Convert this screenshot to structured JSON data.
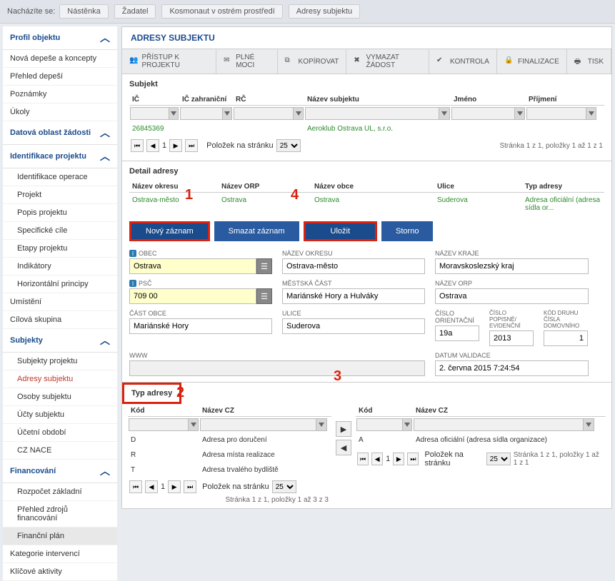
{
  "breadcrumb": {
    "label": "Nacházíte se:",
    "items": [
      "Nástěnka",
      "Žadatel",
      "Kosmonaut v ostrém prostředí",
      "Adresy subjektu"
    ]
  },
  "sidebar": {
    "groups": [
      {
        "title": "Profil objektu",
        "items": [
          "Nová depeše a koncepty",
          "Přehled depeší",
          "Poznámky",
          "Úkoly"
        ]
      },
      {
        "title": "Datová oblast žádosti",
        "items": []
      },
      {
        "title": "Identifikace projektu",
        "items": [
          "Identifikace operace",
          "Projekt",
          "Popis projektu",
          "Specifické cíle",
          "Etapy projektu",
          "Indikátory",
          "Horizontální principy"
        ]
      }
    ],
    "flat1": [
      "Umístění",
      "Cílová skupina"
    ],
    "subjekty": {
      "title": "Subjekty",
      "items": [
        "Subjekty projektu",
        "Adresy subjektu",
        "Osoby subjektu",
        "Účty subjektu",
        "Účetní období",
        "CZ NACE"
      ],
      "active": "Adresy subjektu"
    },
    "financovani": {
      "title": "Financování",
      "items": [
        "Rozpočet základní",
        "Přehled zdrojů financování",
        "Finanční plán"
      ],
      "highlight": "Finanční plán"
    },
    "flat2": [
      "Kategorie intervencí",
      "Klíčové aktivity"
    ]
  },
  "main": {
    "title": "ADRESY SUBJEKTU",
    "toolbar": [
      "PŘÍSTUP K PROJEKTU",
      "PLNÉ MOCI",
      "KOPÍROVAT",
      "VYMAZAT ŽÁDOST",
      "KONTROLA",
      "FINALIZACE",
      "TISK"
    ]
  },
  "subjekt": {
    "title": "Subjekt",
    "cols": [
      "IČ",
      "IČ zahraniční",
      "RČ",
      "Název subjektu",
      "Jméno",
      "Příjmení"
    ],
    "row": {
      "ic": "26845369",
      "nazev": "Aeroklub Ostrava UL, s.r.o."
    },
    "pager": {
      "page": "1",
      "label": "Položek na stránku",
      "per": "25",
      "info": "Stránka 1 z 1, položky 1 až 1 z 1"
    }
  },
  "detail": {
    "title": "Detail adresy",
    "cols": [
      "Název okresu",
      "Název ORP",
      "Název obce",
      "Ulice",
      "Typ adresy"
    ],
    "row": {
      "okres": "Ostrava-město",
      "orp": "Ostrava",
      "obce": "Ostrava",
      "ulice": "Suderova",
      "typ": "Adresa oficiální (adresa sídla or..."
    }
  },
  "actions": {
    "novy": "Nový záznam",
    "smazat": "Smazat záznam",
    "ulozit": "Uložit",
    "storno": "Storno"
  },
  "annotations": {
    "n1": "1",
    "n2": "2",
    "n3": "3",
    "n4": "4"
  },
  "form": {
    "obec": {
      "lbl": "OBEC",
      "val": "Ostrava"
    },
    "nazev_okresu": {
      "lbl": "NÁZEV OKRESU",
      "val": "Ostrava-město"
    },
    "nazev_kraje": {
      "lbl": "NÁZEV KRAJE",
      "val": "Moravskoslezský kraj"
    },
    "psc": {
      "lbl": "PSČ",
      "val": "709 00"
    },
    "mestska_cast": {
      "lbl": "MĚSTSKÁ ČÁST",
      "val": "Mariánské Hory a Hulváky"
    },
    "nazev_orp": {
      "lbl": "NÁZEV ORP",
      "val": "Ostrava"
    },
    "cast_obce": {
      "lbl": "ČÁST OBCE",
      "val": "Mariánské Hory"
    },
    "ulice": {
      "lbl": "ULICE",
      "val": "Suderova"
    },
    "cislo_or": {
      "lbl": "ČÍSLO ORIENTAČNÍ",
      "val": "19a"
    },
    "cislo_pop": {
      "lbl": "ČÍSLO POPISNÉ/ EVIDENČNÍ",
      "val": "2013"
    },
    "kod_druhu": {
      "lbl": "KÓD DRUHU ČÍSLA DOMOVNÍHO",
      "val": "1"
    },
    "www": {
      "lbl": "WWW",
      "val": ""
    },
    "datum_val": {
      "lbl": "DATUM VALIDACE",
      "val": "2. června 2015 7:24:54"
    }
  },
  "typ_adresy": {
    "title": "Typ adresy",
    "cols": [
      "Kód",
      "Název CZ"
    ],
    "left_rows": [
      {
        "k": "D",
        "n": "Adresa pro doručení"
      },
      {
        "k": "R",
        "n": "Adresa místa realizace"
      },
      {
        "k": "T",
        "n": "Adresa trvalého bydliště"
      }
    ],
    "right_rows": [
      {
        "k": "A",
        "n": "Adresa oficiální (adresa sídla organizace)"
      }
    ],
    "pager_left": {
      "page": "1",
      "label": "Položek na stránku",
      "per": "25",
      "info": "Stránka 1 z 1, položky 1 až 3 z 3"
    },
    "pager_right": {
      "page": "1",
      "label": "Položek na stránku",
      "per": "25",
      "info": "Stránka 1 z 1, položky 1 až 1 z 1"
    }
  }
}
